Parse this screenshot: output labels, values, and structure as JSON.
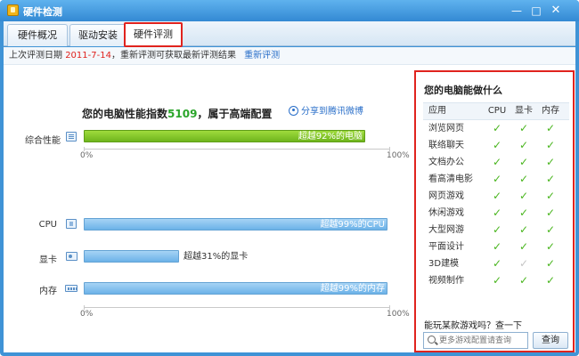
{
  "window": {
    "title": "硬件检测",
    "min": "—",
    "max": "□",
    "close": "✕"
  },
  "tabs": [
    {
      "label": "硬件概况"
    },
    {
      "label": "驱动安装"
    },
    {
      "label": "硬件评测",
      "selected": true
    }
  ],
  "info": {
    "prefix": "上次评测日期",
    "date": "2011-7-14",
    "suffix": "，重新评测可获取最新评测结果",
    "link": "重新评测"
  },
  "score": {
    "prefix": "您的电脑性能指数",
    "value": "5109",
    "suffix": "，属于高端配置",
    "share": "分享到腾讯微博"
  },
  "overall": {
    "label": "综合性能",
    "bar_text": "超越92%的电脑",
    "percent": 92
  },
  "components": [
    {
      "label": "CPU",
      "bar_text": "超越99%的CPU",
      "percent": 99
    },
    {
      "label": "显卡",
      "bar_text": "超越31%的显卡",
      "percent": 31
    },
    {
      "label": "内存",
      "bar_text": "超越99%的内存",
      "percent": 99
    }
  ],
  "axis": {
    "min": "0%",
    "max": "100%"
  },
  "capabilities": {
    "title": "您的电脑能做什么",
    "headers": {
      "app": "应用",
      "cpu": "CPU",
      "gpu": "显卡",
      "mem": "内存"
    },
    "rows": [
      {
        "app": "浏览网页",
        "cpu": true,
        "gpu": true,
        "mem": true
      },
      {
        "app": "联络聊天",
        "cpu": true,
        "gpu": true,
        "mem": true
      },
      {
        "app": "文档办公",
        "cpu": true,
        "gpu": true,
        "mem": true
      },
      {
        "app": "看高清电影",
        "cpu": true,
        "gpu": true,
        "mem": true
      },
      {
        "app": "网页游戏",
        "cpu": true,
        "gpu": true,
        "mem": true
      },
      {
        "app": "休闲游戏",
        "cpu": true,
        "gpu": true,
        "mem": true
      },
      {
        "app": "大型网游",
        "cpu": true,
        "gpu": true,
        "mem": true
      },
      {
        "app": "平面设计",
        "cpu": true,
        "gpu": true,
        "mem": true
      },
      {
        "app": "3D建模",
        "cpu": true,
        "gpu": false,
        "mem": true
      },
      {
        "app": "视频制作",
        "cpu": true,
        "gpu": true,
        "mem": true
      }
    ],
    "check_glyph": "✓",
    "question": "能玩某款游戏吗？查一下",
    "search_placeholder": "更多游戏配置请查询",
    "search_button": "查询"
  }
}
